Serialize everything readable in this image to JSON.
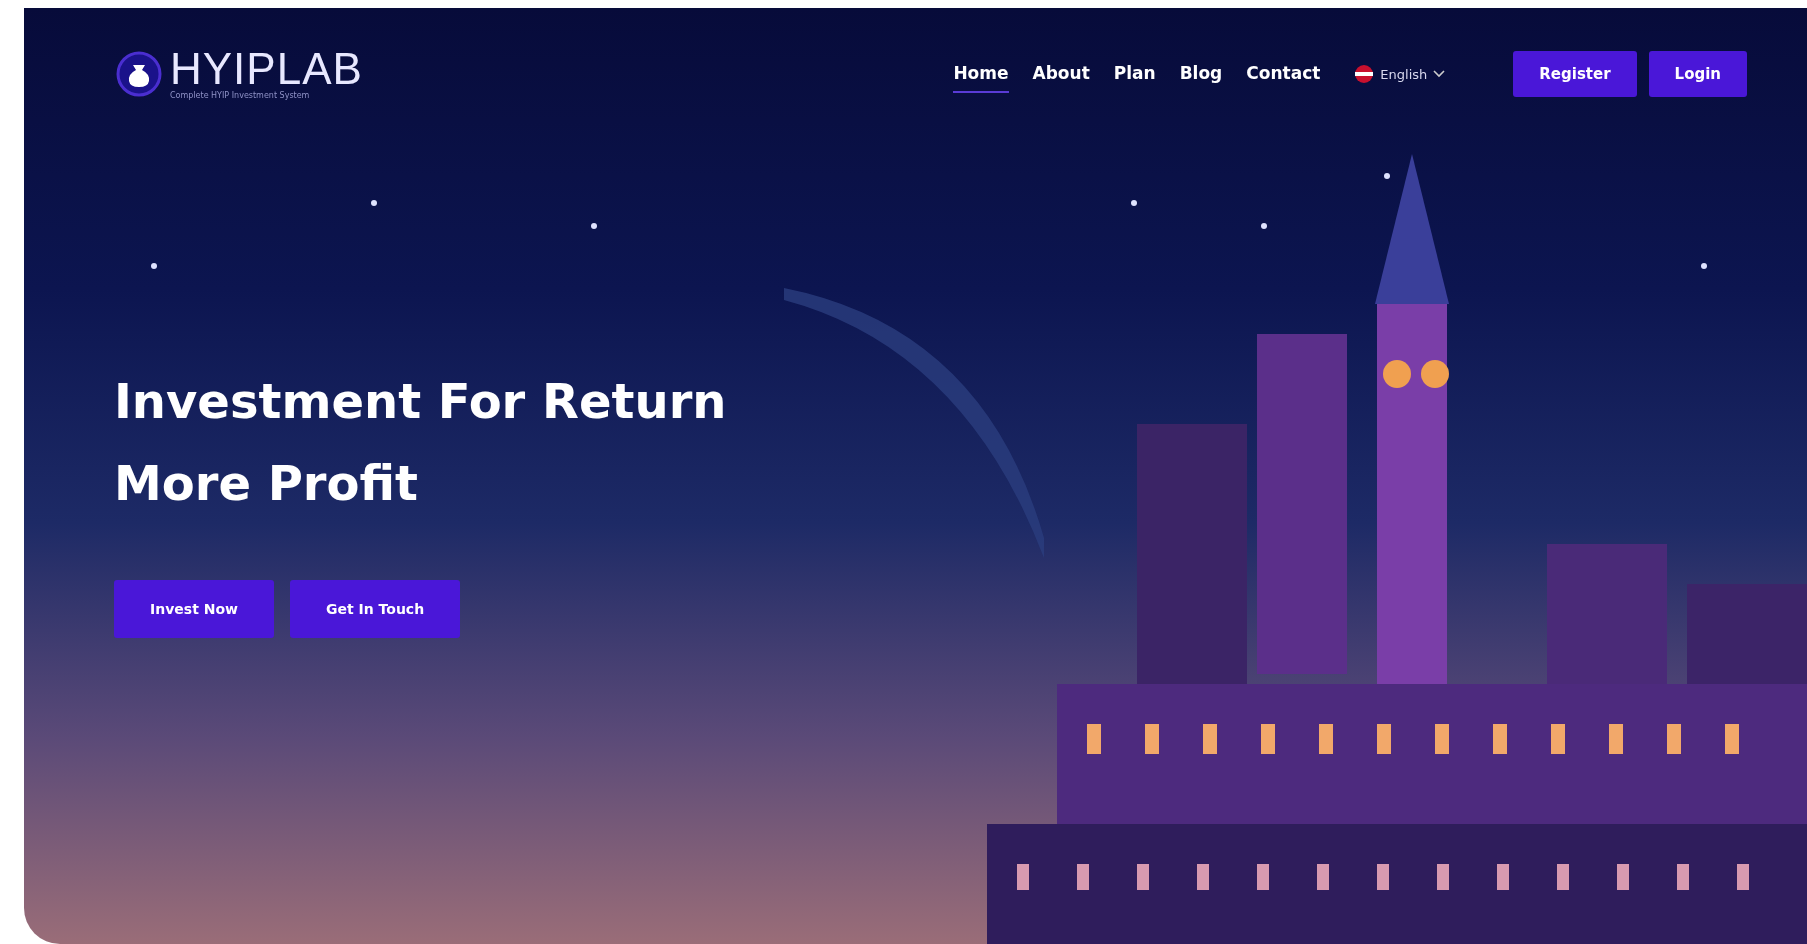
{
  "logo": {
    "name": "HYIPLAB",
    "tagline": "Complete HYIP Investment System"
  },
  "nav": [
    {
      "label": "Home",
      "selected": true
    },
    {
      "label": "About",
      "selected": false
    },
    {
      "label": "Plan",
      "selected": false
    },
    {
      "label": "Blog",
      "selected": false
    },
    {
      "label": "Contact",
      "selected": false
    }
  ],
  "language": {
    "label": "English"
  },
  "auth_buttons": [
    "Register",
    "Login"
  ],
  "hero": {
    "title_lines": [
      "Investment For Return",
      "More Profit"
    ],
    "buttons": [
      "Invest Now",
      "Get In Touch"
    ]
  }
}
